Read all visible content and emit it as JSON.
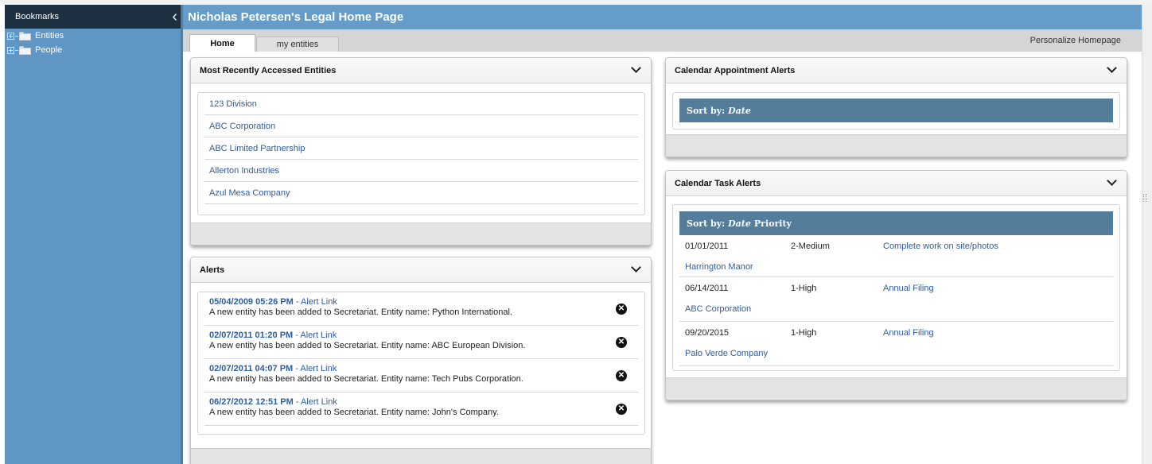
{
  "sidebar": {
    "title": "Bookmarks",
    "items": [
      {
        "label": "Entities",
        "icon": "folder-icon"
      },
      {
        "label": "People",
        "icon": "folder-icon"
      }
    ]
  },
  "header": {
    "title": "Nicholas Petersen's Legal Home Page"
  },
  "tabs": {
    "home": "Home",
    "my_entities": "my entities",
    "personalize": "Personalize Homepage"
  },
  "recent": {
    "title": "Most Recently Accessed Entities",
    "items": [
      "123 Division",
      "ABC Corporation",
      "ABC Limited Partnership",
      "Allerton Industries",
      "Azul Mesa Company"
    ]
  },
  "alerts": {
    "title": "Alerts",
    "items": [
      {
        "datetime": "05/04/2009 05:26 PM",
        "link": "- Alert Link",
        "message": "A new entity has been added to Secretariat. Entity name: Python International."
      },
      {
        "datetime": "02/07/2011 01:20 PM",
        "link": "- Alert Link",
        "message": "A new entity has been added to Secretariat. Entity name: ABC European Division."
      },
      {
        "datetime": "02/07/2011 04:07 PM",
        "link": "- Alert Link",
        "message": "A new entity has been added to Secretariat. Entity name: Tech Pubs Corporation."
      },
      {
        "datetime": "06/27/2012 12:51 PM",
        "link": "- Alert Link",
        "message": "A new entity has been added to Secretariat. Entity name: John's Company."
      }
    ]
  },
  "appointments": {
    "title": "Calendar Appointment Alerts",
    "sort_label": "Sort by:",
    "sort_field": "Date"
  },
  "tasks": {
    "title": "Calendar Task Alerts",
    "sort_label": "Sort by:",
    "sort_field": "Date",
    "sort_extra": "Priority",
    "items": [
      {
        "date": "01/01/2011",
        "priority": "2-Medium",
        "task": "Complete work on site/photos",
        "entity": "Harrington Manor"
      },
      {
        "date": "06/14/2011",
        "priority": "1-High",
        "task": "Annual Filing",
        "entity": "ABC Corporation"
      },
      {
        "date": "09/20/2015",
        "priority": "1-High",
        "task": "Annual Filing",
        "entity": "Palo Verde Company"
      }
    ]
  },
  "colors": {
    "header_bg": "#659cc8",
    "sidebar_bg": "#5f96c4",
    "sidebar_header_bg": "#1d3042",
    "sort_bar_bg": "#537d9b",
    "link": "#2f5d9b"
  }
}
